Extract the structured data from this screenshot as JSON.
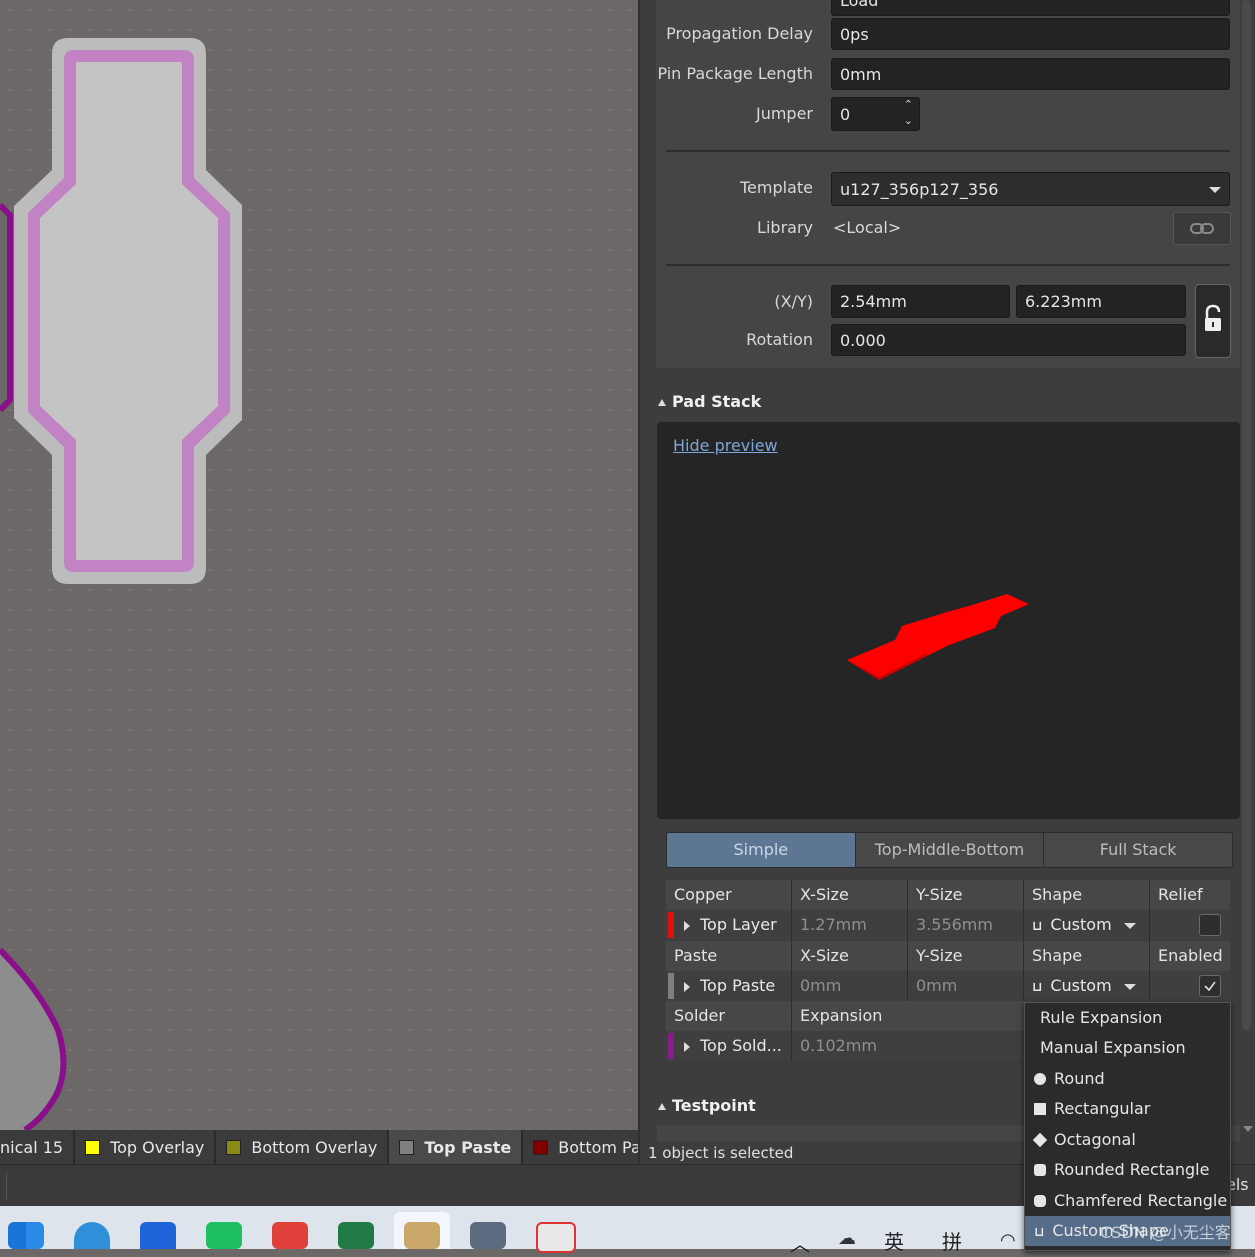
{
  "properties": {
    "electrical_type_value": "Load",
    "propagation_delay": {
      "label": "Propagation Delay",
      "value": "0ps"
    },
    "pin_package_length": {
      "label": "Pin Package Length",
      "value": "0mm"
    },
    "jumper": {
      "label": "Jumper",
      "value": "0"
    },
    "template": {
      "label": "Template",
      "value": "u127_356p127_356"
    },
    "library": {
      "label": "Library",
      "value": "<Local>"
    },
    "xy": {
      "label": "(X/Y)",
      "x": "2.54mm",
      "y": "6.223mm"
    },
    "rotation": {
      "label": "Rotation",
      "value": "0.000"
    }
  },
  "pad_stack": {
    "title": "Pad Stack",
    "hide_preview": "Hide preview",
    "modes": [
      "Simple",
      "Top-Middle-Bottom",
      "Full Stack"
    ],
    "active_mode": "Simple",
    "copper_header": [
      "Copper",
      "X-Size",
      "Y-Size",
      "Shape",
      "Relief"
    ],
    "copper_row": {
      "layer": "Top Layer",
      "x": "1.27mm",
      "y": "3.556mm",
      "shape": "Custom",
      "color": "#e01010"
    },
    "paste_header": [
      "Paste",
      "X-Size",
      "Y-Size",
      "Shape",
      "Enabled"
    ],
    "paste_row": {
      "layer": "Top Paste",
      "x": "0mm",
      "y": "0mm",
      "shape": "Custom",
      "color": "#808080"
    },
    "solder_header": [
      "Solder",
      "Expansion"
    ],
    "solder_row": {
      "layer": "Top Sold...",
      "expansion": "0.102mm",
      "color": "#8b1a8b"
    }
  },
  "shape_dropdown": {
    "items": [
      "Rule Expansion",
      "Manual Expansion",
      "Round",
      "Rectangular",
      "Octagonal",
      "Rounded Rectangle",
      "Chamfered Rectangle",
      "Custom Shape"
    ],
    "selected": "Custom Shape"
  },
  "testpoint": {
    "title": "Testpoint"
  },
  "status": "1 object is selected",
  "layer_tabs": [
    {
      "label": "nical 15",
      "color": ""
    },
    {
      "label": "Top Overlay",
      "color": "#ffff00"
    },
    {
      "label": "Bottom Overlay",
      "color": "#8a8a14"
    },
    {
      "label": "Top Paste",
      "color": "#808080"
    },
    {
      "label": "Bottom Paste",
      "color": "#800000"
    }
  ],
  "panels_button": "els",
  "taskbar": {
    "ime_1": "英",
    "ime_2": "拼"
  },
  "watermark": "CSDN @小无尘客",
  "colors": {
    "preview_pad": "#ff0000",
    "pad_outline": "#c080c0",
    "canvas_bg": "#6b6867"
  }
}
